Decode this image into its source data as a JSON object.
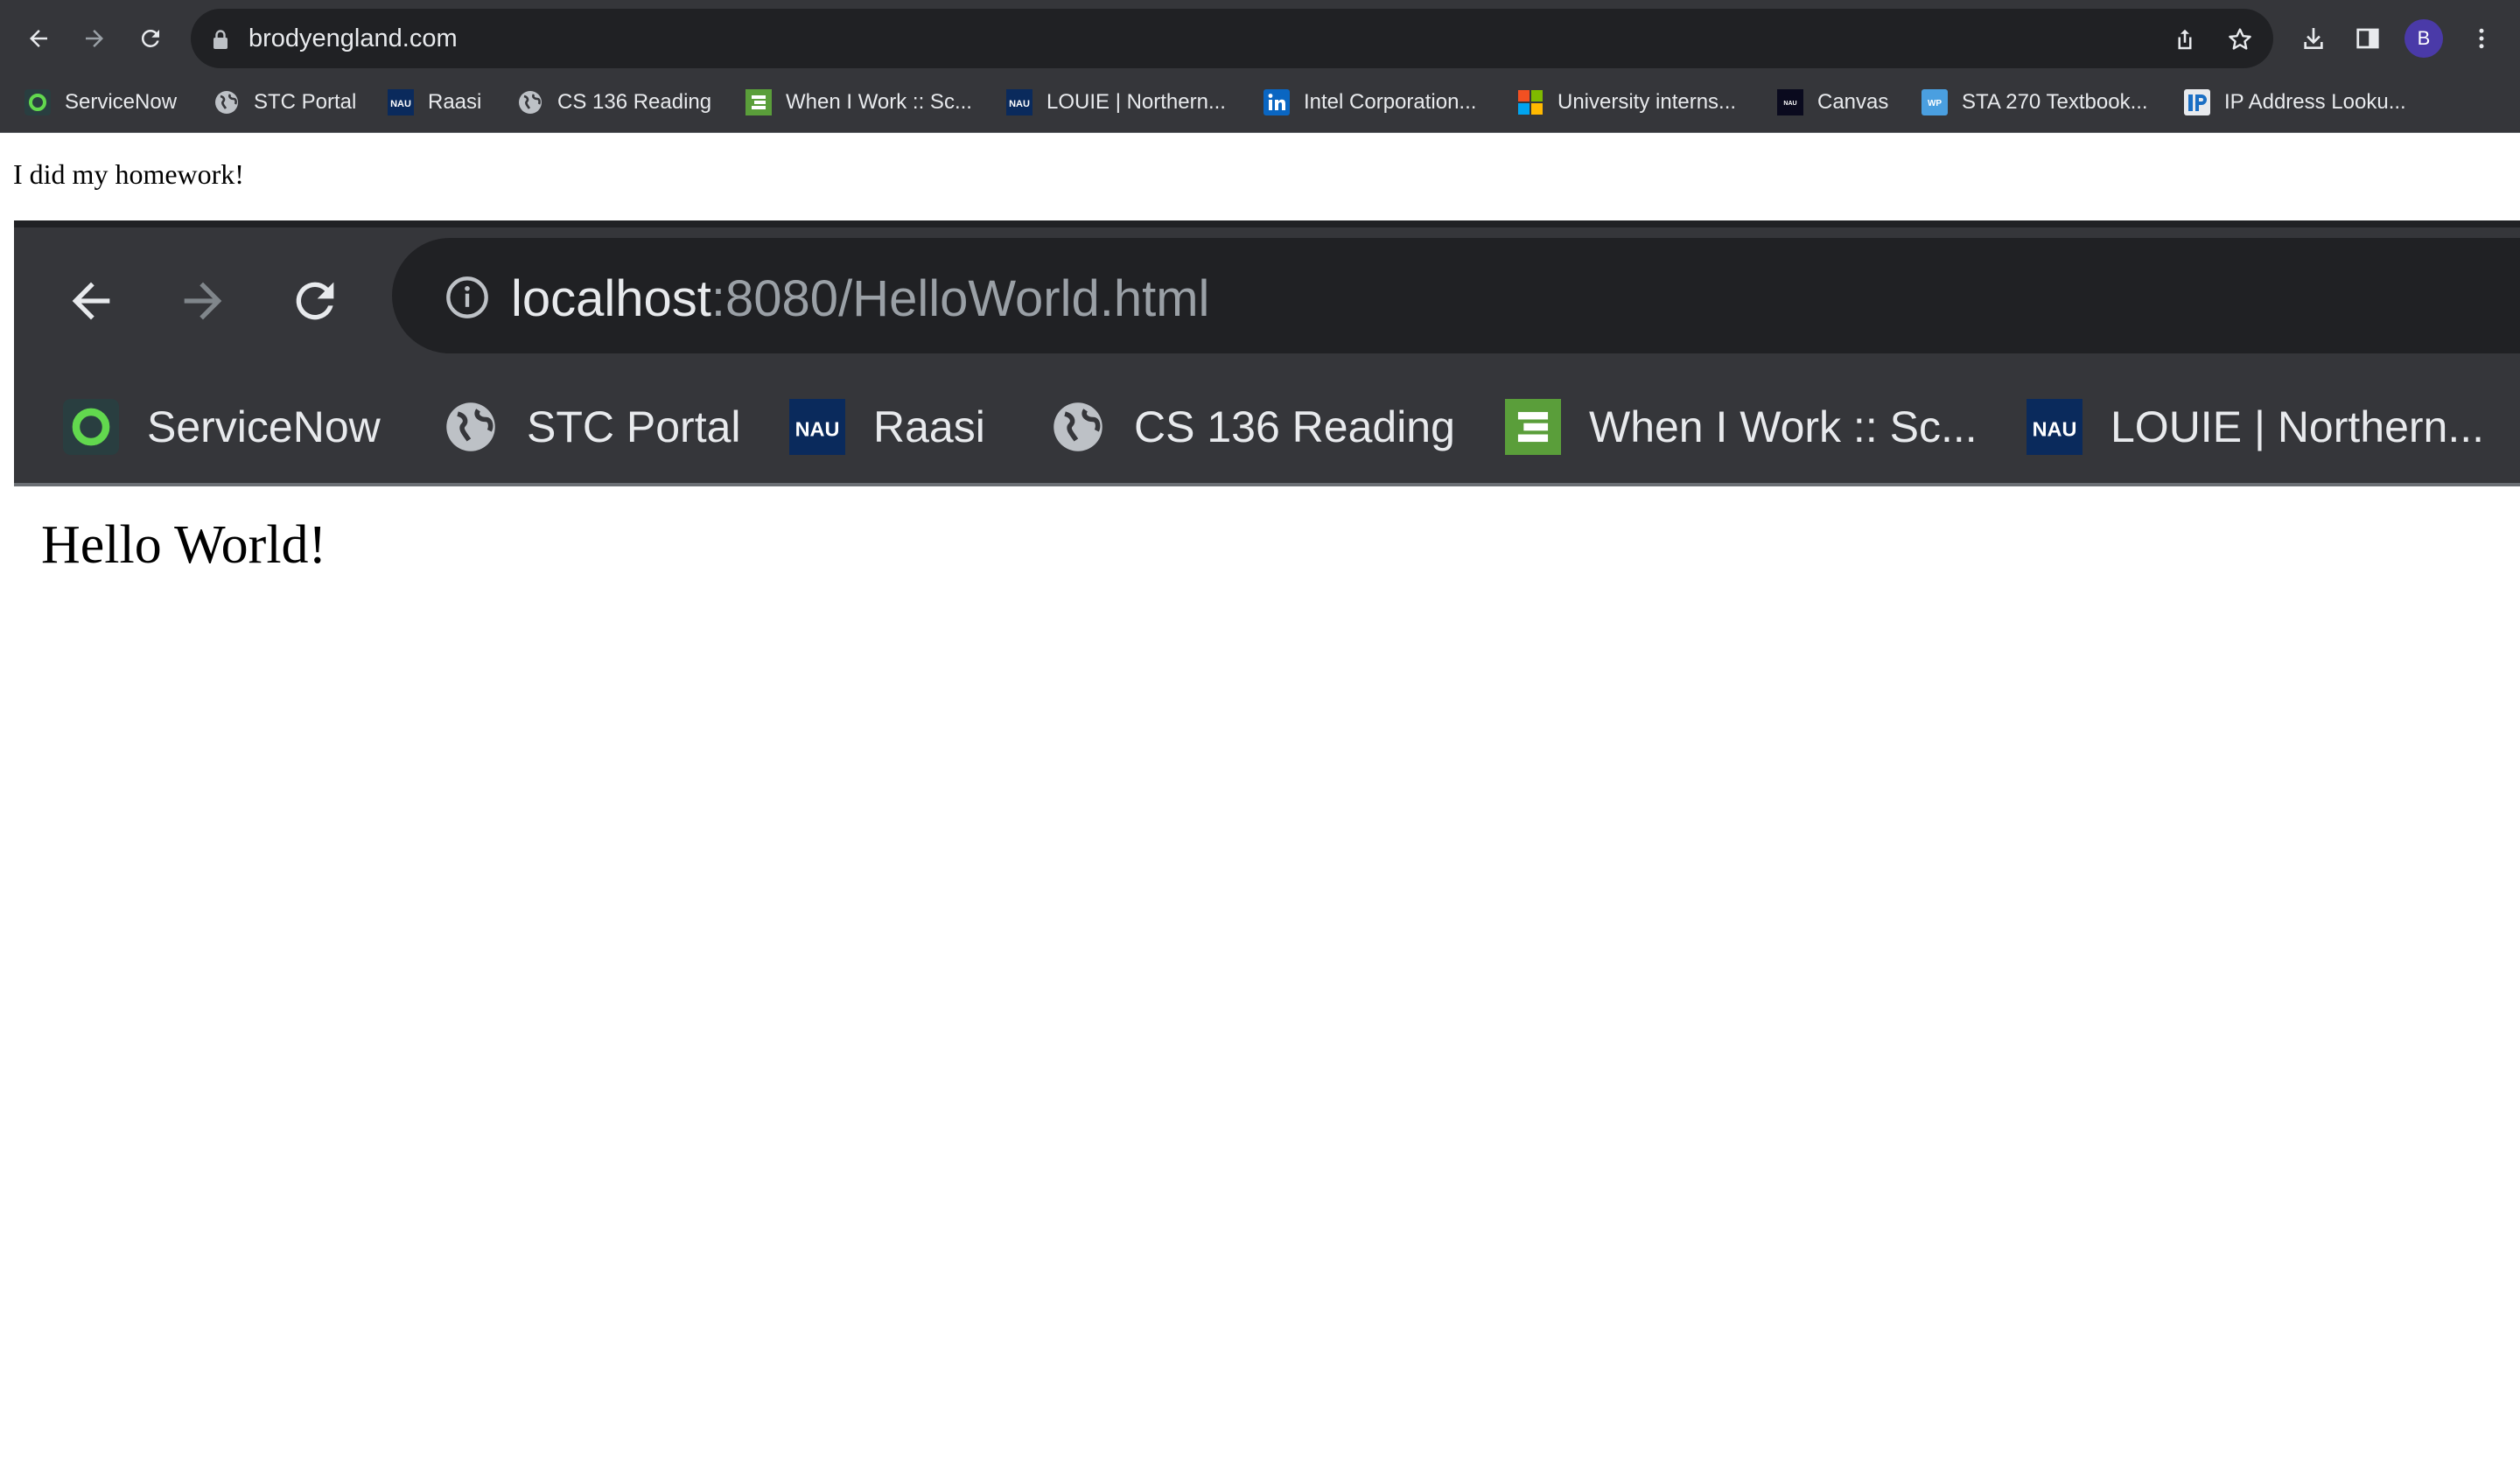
{
  "browser": {
    "url": "brodyengland.com",
    "profile_initial": "B",
    "bookmarks": [
      {
        "label": "ServiceNow",
        "icon": "servicenow-icon"
      },
      {
        "label": "STC Portal",
        "icon": "globe-icon"
      },
      {
        "label": "Raasi",
        "icon": "nau-icon"
      },
      {
        "label": "CS 136 Reading",
        "icon": "globe-icon"
      },
      {
        "label": "When I Work :: Sc...",
        "icon": "wheniwork-icon"
      },
      {
        "label": "LOUIE | Northern...",
        "icon": "nau-icon"
      },
      {
        "label": "Intel Corporation...",
        "icon": "linkedin-icon"
      },
      {
        "label": "University interns...",
        "icon": "microsoft-icon"
      },
      {
        "label": "Canvas",
        "icon": "nau-icon"
      },
      {
        "label": "STA 270 Textbook...",
        "icon": "wp-icon"
      },
      {
        "label": "IP Address Looku...",
        "icon": "ip-icon"
      }
    ],
    "nau_badge": "NAU",
    "wp_badge": "WP"
  },
  "page": {
    "text": "I did my homework!"
  },
  "screenshot": {
    "url_host": "localhost",
    "url_path": ":8080/HelloWorld.html",
    "bookmarks": [
      {
        "label": "ServiceNow",
        "icon": "servicenow-icon"
      },
      {
        "label": "STC Portal",
        "icon": "globe-icon"
      },
      {
        "label": "Raasi",
        "icon": "nau-icon"
      },
      {
        "label": "CS 136 Reading",
        "icon": "globe-icon"
      },
      {
        "label": "When I Work :: Sc...",
        "icon": "wheniwork-icon"
      },
      {
        "label": "LOUIE | Northern...",
        "icon": "nau-icon"
      }
    ],
    "heading": "Hello World!"
  },
  "colors": {
    "chrome": "#35363a",
    "omnibox": "#202124",
    "text_light": "#e8eaed",
    "servicenow_green": "#62d84e",
    "wheniwork_green": "#5a9e3a",
    "nau_navy": "#0a2a5c",
    "linkedin_blue": "#0a66c2",
    "wp_blue": "#4a9fe0",
    "avatar_purple": "#4a3aa8"
  }
}
